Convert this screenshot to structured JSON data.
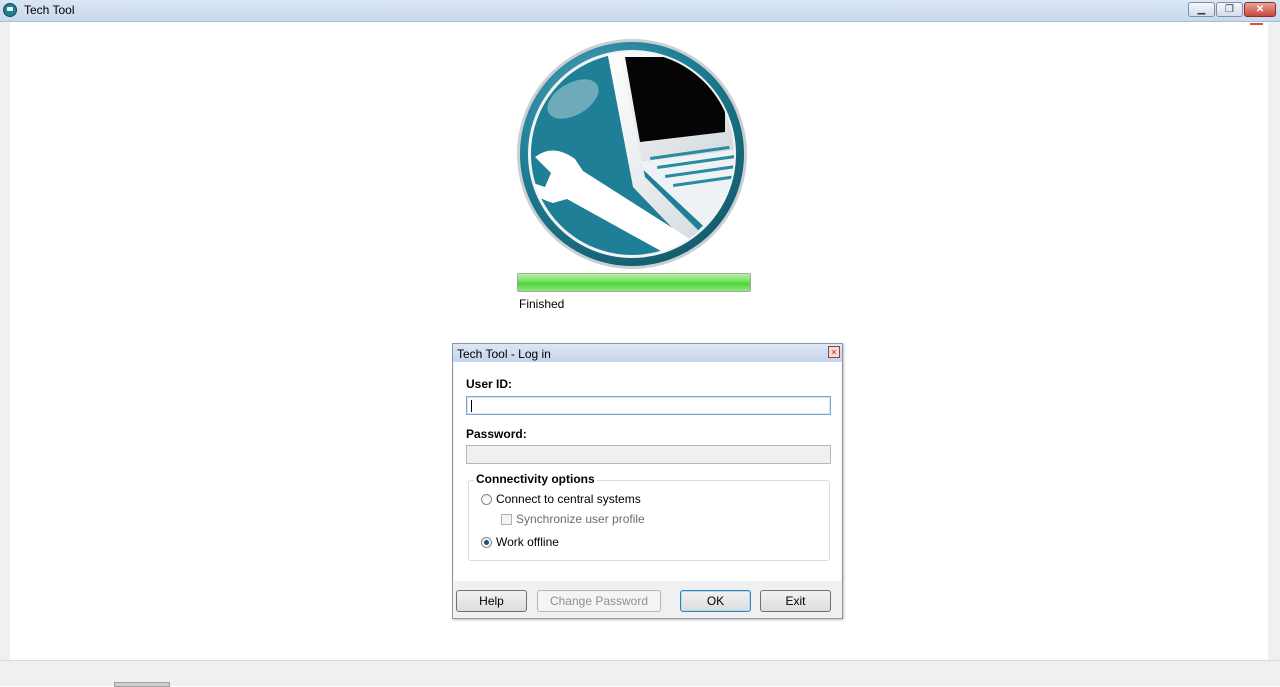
{
  "window": {
    "title": "Tech Tool",
    "controls": {
      "minimize": "▁",
      "restore": "❐",
      "close": "✕"
    }
  },
  "splash": {
    "progress_percent": 100,
    "status": "Finished"
  },
  "login_dialog": {
    "title": "Tech Tool - Log in",
    "close_glyph": "×",
    "user_id": {
      "label": "User ID:",
      "value": ""
    },
    "password": {
      "label": "Password:",
      "value": ""
    },
    "connectivity": {
      "legend": "Connectivity options",
      "options": {
        "central": {
          "label": "Connect to central systems",
          "selected": false
        },
        "sync": {
          "label": "Synchronize user profile",
          "checked": false,
          "enabled": false
        },
        "offline": {
          "label": "Work offline",
          "selected": true
        }
      }
    },
    "buttons": {
      "help": "Help",
      "change_password": "Change Password",
      "ok": "OK",
      "exit": "Exit"
    }
  },
  "colors": {
    "logo_teal": "#1f7f96",
    "progress_green": "#4fcf3b",
    "title_bar": "#c8d8ee"
  }
}
